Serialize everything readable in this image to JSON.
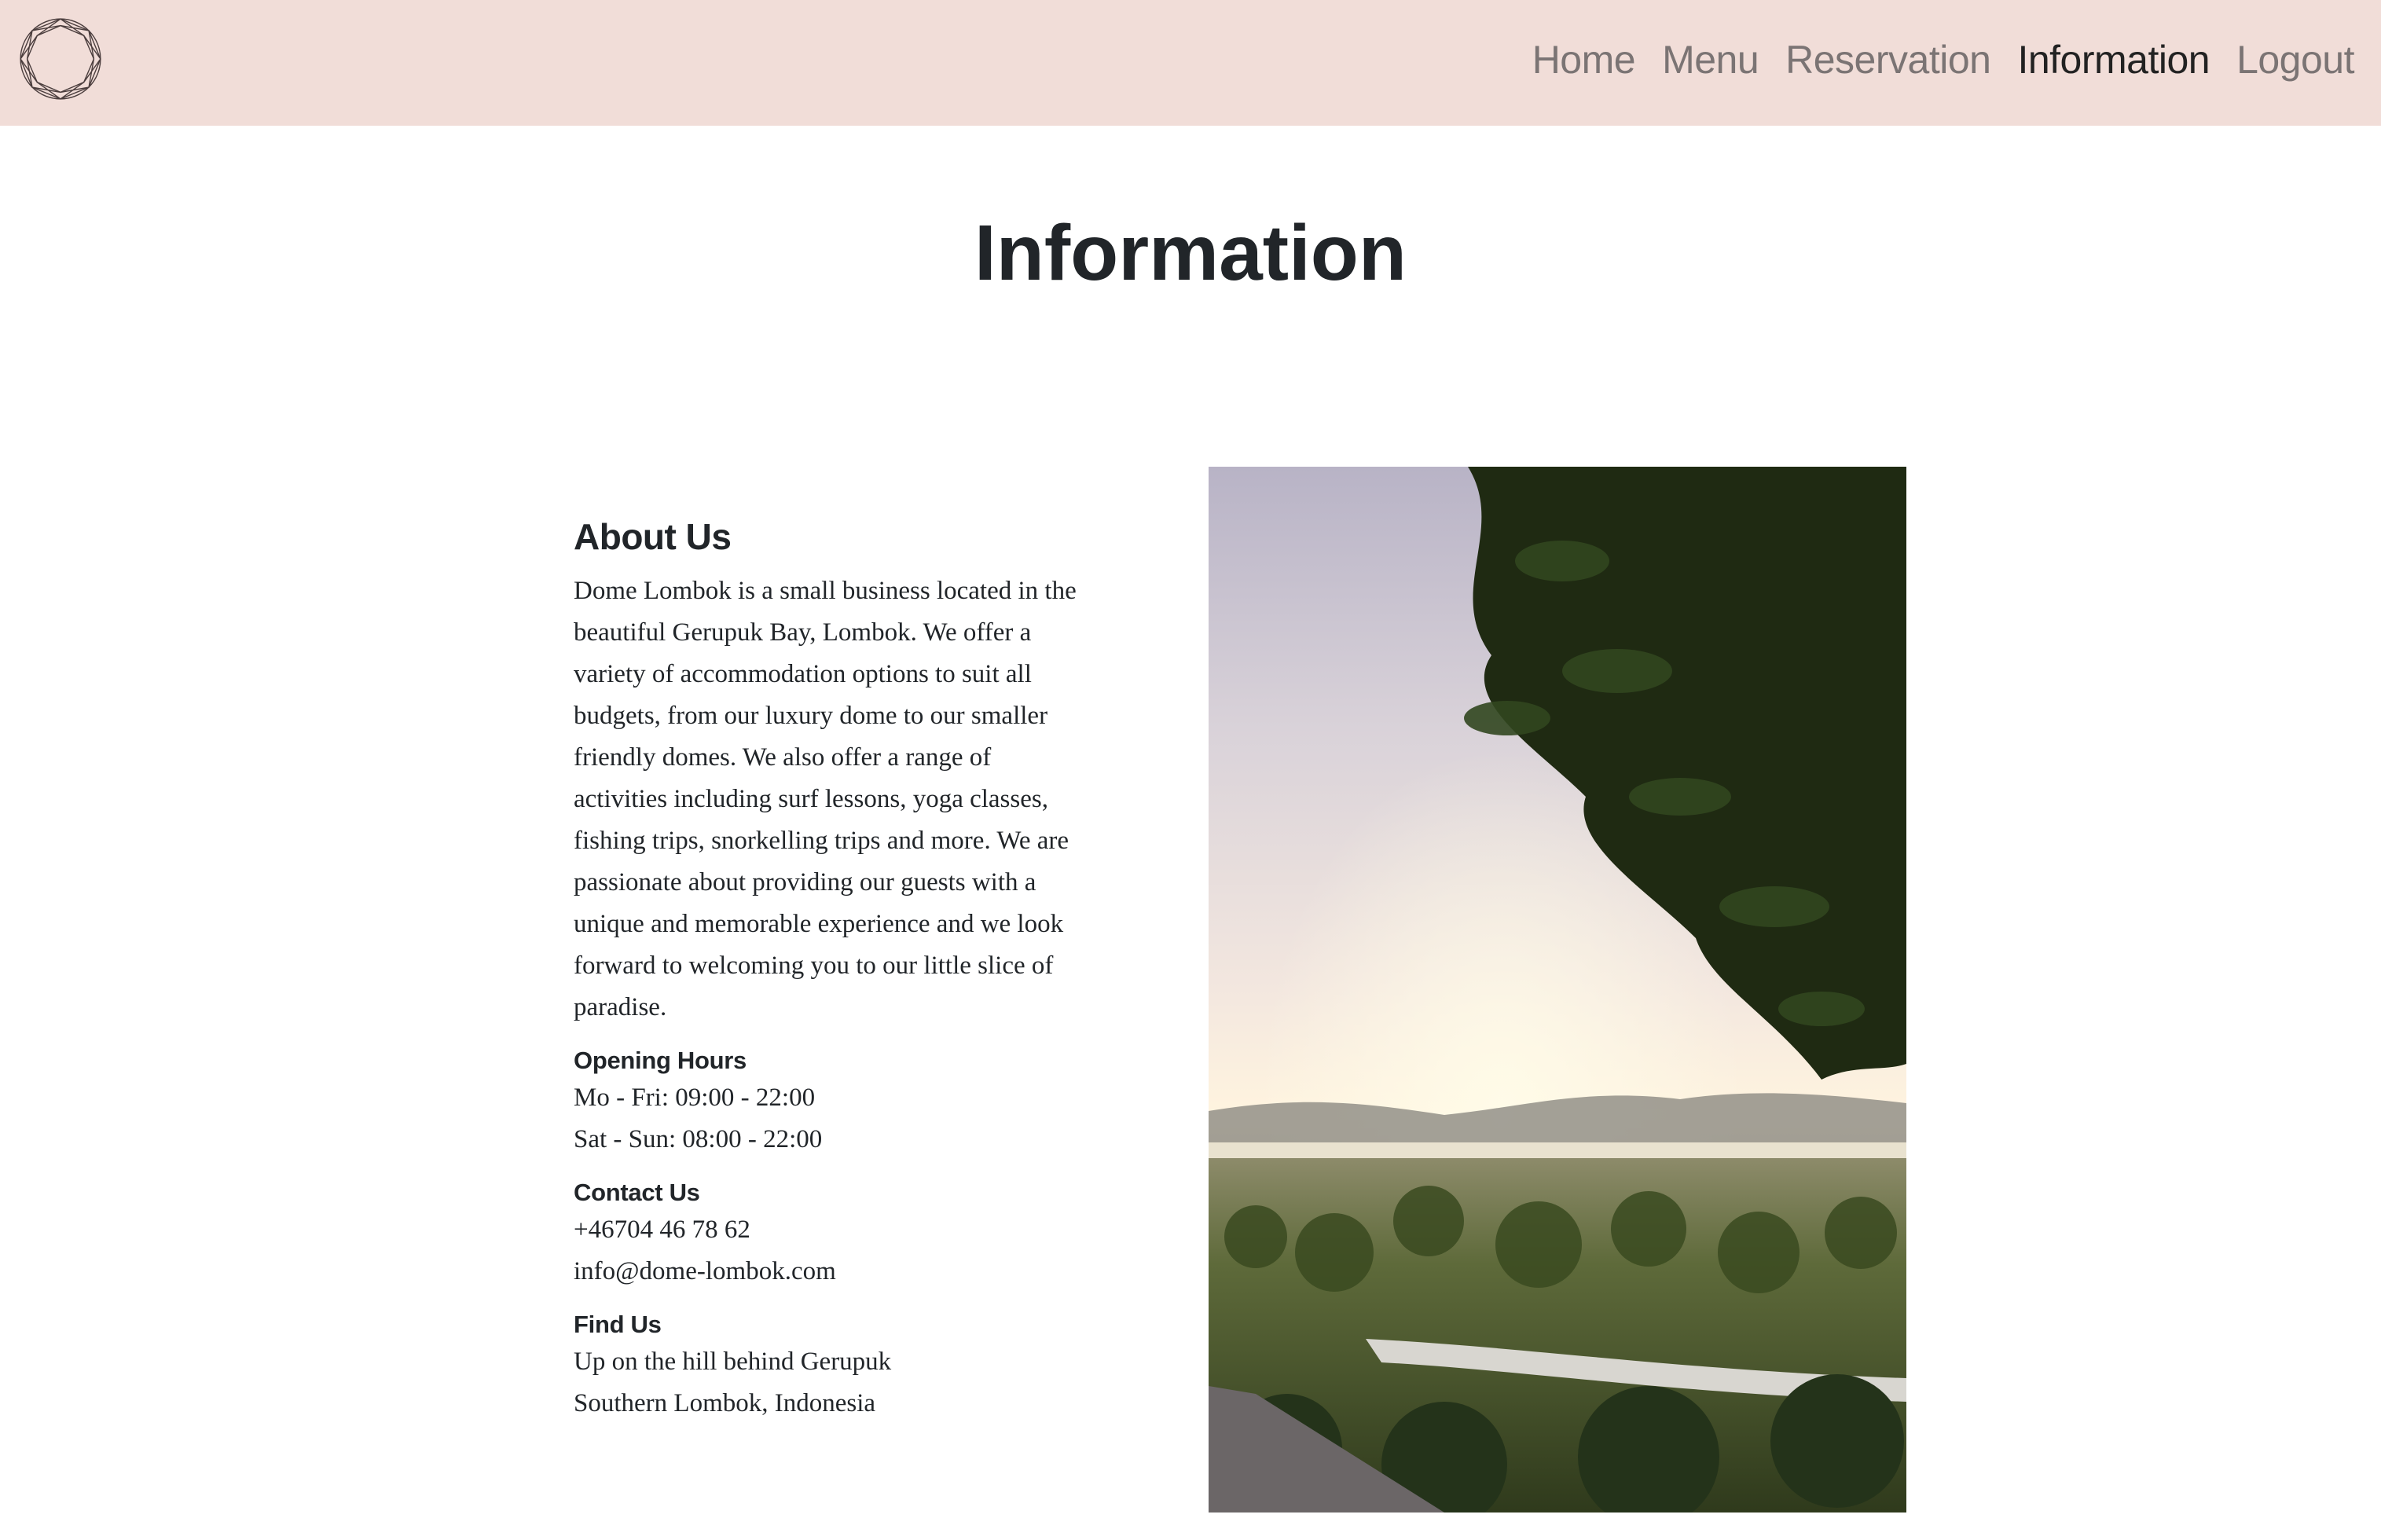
{
  "nav": {
    "items": [
      {
        "label": "Home",
        "active": false
      },
      {
        "label": "Menu",
        "active": false
      },
      {
        "label": "Reservation",
        "active": false
      },
      {
        "label": "Information",
        "active": true
      },
      {
        "label": "Logout",
        "active": false
      }
    ]
  },
  "logo_icon": "geometric-diamond-circle-icon",
  "page": {
    "title": "Information"
  },
  "about": {
    "heading": "About Us",
    "text": "Dome Lombok is a small business located in the beautiful Gerupuk Bay, Lombok. We offer a variety of accommodation options to suit all budgets, from our luxury dome to our smaller friendly domes. We also offer a range of activities including surf lessons, yoga classes, fishing trips, snorkelling trips and more. We are passionate about providing our guests with a unique and memorable experience and we look forward to welcoming you to our little slice of paradise."
  },
  "hours": {
    "heading": "Opening Hours",
    "weekdays": "Mo - Fri: 09:00 - 22:00",
    "weekend": "Sat - Sun: 08:00 - 22:00"
  },
  "contact": {
    "heading": "Contact Us",
    "phone": "+46704 46 78 62",
    "email": "info@dome-lombok.com"
  },
  "find": {
    "heading": "Find Us",
    "line1": "Up on the hill behind Gerupuk",
    "line2": "Southern Lombok, Indonesia"
  },
  "colors": {
    "navbar_bg": "#f1ddd8",
    "text": "#212529",
    "nav_inactive": "#7b7474",
    "nav_active": "#222222"
  }
}
